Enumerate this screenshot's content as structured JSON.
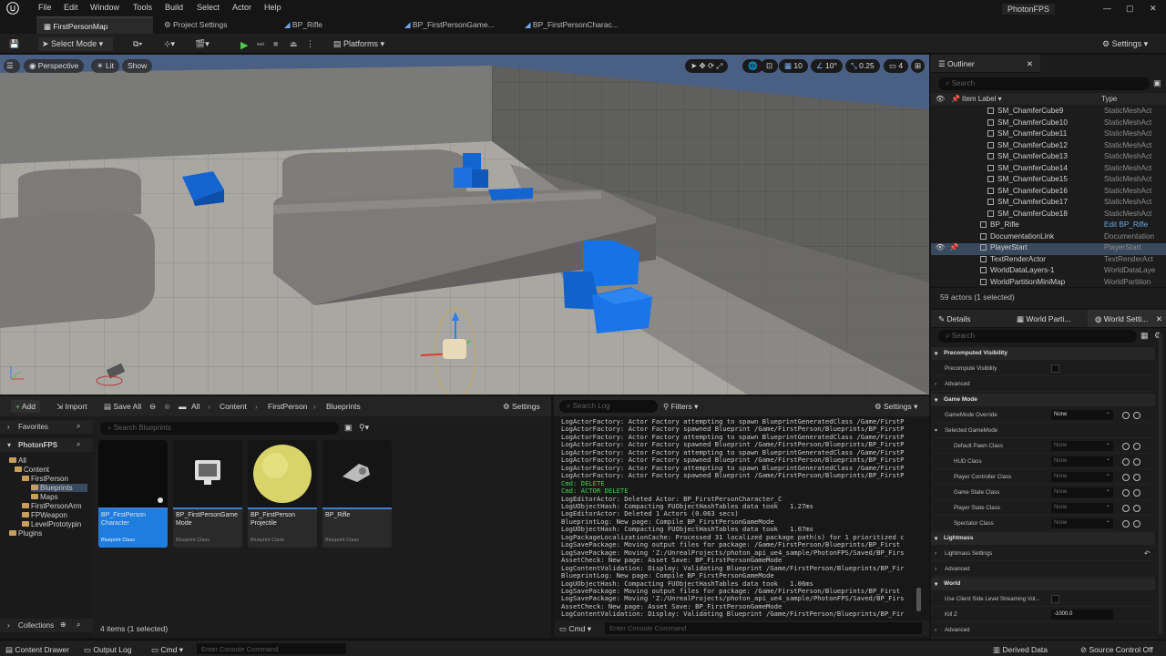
{
  "menu": {
    "items": [
      "File",
      "Edit",
      "Window",
      "Tools",
      "Build",
      "Select",
      "Actor",
      "Help"
    ],
    "project": "PhotonFPS"
  },
  "tabs": [
    "FirstPersonMap",
    "Project Settings",
    "BP_Rifle",
    "BP_FirstPersonGame...",
    "BP_FirstPersonCharac..."
  ],
  "toolbar": {
    "select_mode": "Select Mode",
    "platforms": "Platforms",
    "settings": "Settings"
  },
  "viewport": {
    "perspective": "Perspective",
    "lit": "Lit",
    "show": "Show",
    "grid": "10",
    "angle": "10°",
    "scale": "0.25",
    "camera_speed": "4"
  },
  "outliner": {
    "title": "Outliner",
    "search_placeholder": "Search",
    "col_label": "Item Label ▾",
    "col_type": "Type",
    "rows": [
      {
        "name": "SM_ChamferCube9",
        "type": "StaticMeshAct"
      },
      {
        "name": "SM_ChamferCube10",
        "type": "StaticMeshAct"
      },
      {
        "name": "SM_ChamferCube11",
        "type": "StaticMeshAct"
      },
      {
        "name": "SM_ChamferCube12",
        "type": "StaticMeshAct"
      },
      {
        "name": "SM_ChamferCube13",
        "type": "StaticMeshAct"
      },
      {
        "name": "SM_ChamferCube14",
        "type": "StaticMeshAct"
      },
      {
        "name": "SM_ChamferCube15",
        "type": "StaticMeshAct"
      },
      {
        "name": "SM_ChamferCube16",
        "type": "StaticMeshAct"
      },
      {
        "name": "SM_ChamferCube17",
        "type": "StaticMeshAct"
      },
      {
        "name": "SM_ChamferCube18",
        "type": "StaticMeshAct"
      },
      {
        "name": "BP_Rifle",
        "type": "Edit BP_Rifle"
      },
      {
        "name": "DocumentationLink",
        "type": "Documentation"
      },
      {
        "name": "PlayerStart",
        "type": "PlayerStart"
      },
      {
        "name": "TextRenderActor",
        "type": "TextRenderAct"
      },
      {
        "name": "WorldDataLayers-1",
        "type": "WorldDataLaye"
      },
      {
        "name": "WorldPartitionMiniMap",
        "type": "WorldPartition"
      }
    ],
    "count": "59 actors (1 selected)"
  },
  "details": {
    "tabs": [
      "Details",
      "World Parti...",
      "World Setti..."
    ],
    "search_placeholder": "Search",
    "sections": {
      "precomputed": "Precomputed Visibility",
      "precompute_label": "Precompute Visibility",
      "advanced": "Advanced",
      "game_mode": "Game Mode",
      "game_mode_override": "GameMode Override",
      "game_mode_value": "None",
      "selected_game_mode": "Selected GameMode",
      "lightmass": "Lightmass",
      "lightmass_settings": "Lightmass Settings",
      "world": "World",
      "use_client": "Use Client Side Level Streaming Vol...",
      "kill_z": "Kill Z",
      "kill_z_value": "-1000.0"
    },
    "class_rows": [
      {
        "label": "Default Pawn Class",
        "value": "None"
      },
      {
        "label": "HUD Class",
        "value": "None"
      },
      {
        "label": "Player Controller Class",
        "value": "None"
      },
      {
        "label": "Game State Class",
        "value": "None"
      },
      {
        "label": "Player State Class",
        "value": "None"
      },
      {
        "label": "Spectator Class",
        "value": "None"
      }
    ]
  },
  "content_browser": {
    "add": "Add",
    "import": "Import",
    "save_all": "Save All",
    "breadcrumbs": [
      "All",
      "Content",
      "FirstPerson",
      "Blueprints"
    ],
    "settings": "Settings",
    "favorites": "Favorites",
    "project": "PhotonFPS",
    "search_placeholder": "Search Blueprints",
    "tree": [
      "All",
      "Content",
      "FirstPerson",
      "Blueprints",
      "Maps",
      "FirstPersonArm",
      "FPWeapon",
      "LevelPrototypin",
      "Plugins"
    ],
    "collections": "Collections",
    "assets": [
      {
        "name": "BP_FirstPerson Character",
        "class": "Blueprint Class"
      },
      {
        "name": "BP_FirstPersonGame Mode",
        "class": "Blueprint Class"
      },
      {
        "name": "BP_FirstPerson Projectile",
        "class": "Blueprint Class"
      },
      {
        "name": "BP_Rifle",
        "class": "Blueprint Class"
      }
    ],
    "status": "4 items (1 selected)"
  },
  "log": {
    "search_placeholder": "Search Log",
    "filters": "Filters",
    "settings": "Settings",
    "lines": [
      "LogActorFactory: Actor Factory attempting to spawn BlueprintGeneratedClass /Game/FirstP",
      "LogActorFactory: Actor Factory spawned Blueprint /Game/FirstPerson/Blueprints/BP_FirstP",
      "LogActorFactory: Actor Factory attempting to spawn BlueprintGeneratedClass /Game/FirstP",
      "LogActorFactory: Actor Factory spawned Blueprint /Game/FirstPerson/Blueprints/BP_FirstP",
      "LogActorFactory: Actor Factory attempting to spawn BlueprintGeneratedClass /Game/FirstP",
      "LogActorFactory: Actor Factory spawned Blueprint /Game/FirstPerson/Blueprints/BP_FirstP",
      "LogActorFactory: Actor Factory attempting to spawn BlueprintGeneratedClass /Game/FirstP",
      "LogActorFactory: Actor Factory spawned Blueprint /Game/FirstPerson/Blueprints/BP_FirstP",
      "Cmd: DELETE",
      "Cmd: ACTOR DELETE",
      "LogEditorActor: Deleted Actor: BP_FirstPersonCharacter_C",
      "LogUObjectHash: Compacting FUObjectHashTables data took   1.27ms",
      "LogEditorActor: Deleted 1 Actors (0.063 secs)",
      "BlueprintLog: New page: Compile BP_FirstPersonGameMode",
      "LogUObjectHash: Compacting FUObjectHashTables data took   1.07ms",
      "LogPackageLocalizationCache: Processed 31 localized package path(s) for 1 prioritized c",
      "LogSavePackage: Moving output files for package: /Game/FirstPerson/Blueprints/BP_First",
      "LogSavePackage: Moving 'Z:/UnrealProjects/photon_api_ue4_sample/PhotonFPS/Saved/BP_Firs",
      "AssetCheck: New page: Asset Save: BP_FirstPersonGameMode",
      "LogContentValidation: Display: Validating Blueprint /Game/FirstPerson/Blueprints/BP_Fir",
      "BlueprintLog: New page: Compile BP_FirstPersonGameMode",
      "LogUObjectHash: Compacting FUObjectHashTables data took   1.06ms",
      "LogSavePackage: Moving output files for package: /Game/FirstPerson/Blueprints/BP_First",
      "LogSavePackage: Moving 'Z:/UnrealProjects/photon_api_ue4_sample/PhotonFPS/Saved/BP_Firs",
      "AssetCheck: New page: Asset Save: BP_FirstPersonGameMode",
      "LogContentValidation: Display: Validating Blueprint /Game/FirstPerson/Blueprints/BP_Fir"
    ],
    "cmd": "Cmd",
    "cmd_placeholder": "Enter Console Command"
  },
  "statusbar": {
    "content_drawer": "Content Drawer",
    "output_log": "Output Log",
    "cmd": "Cmd",
    "cmd_placeholder": "Enter Console Command",
    "derived_data": "Derived Data",
    "source_control": "Source Control Off"
  }
}
